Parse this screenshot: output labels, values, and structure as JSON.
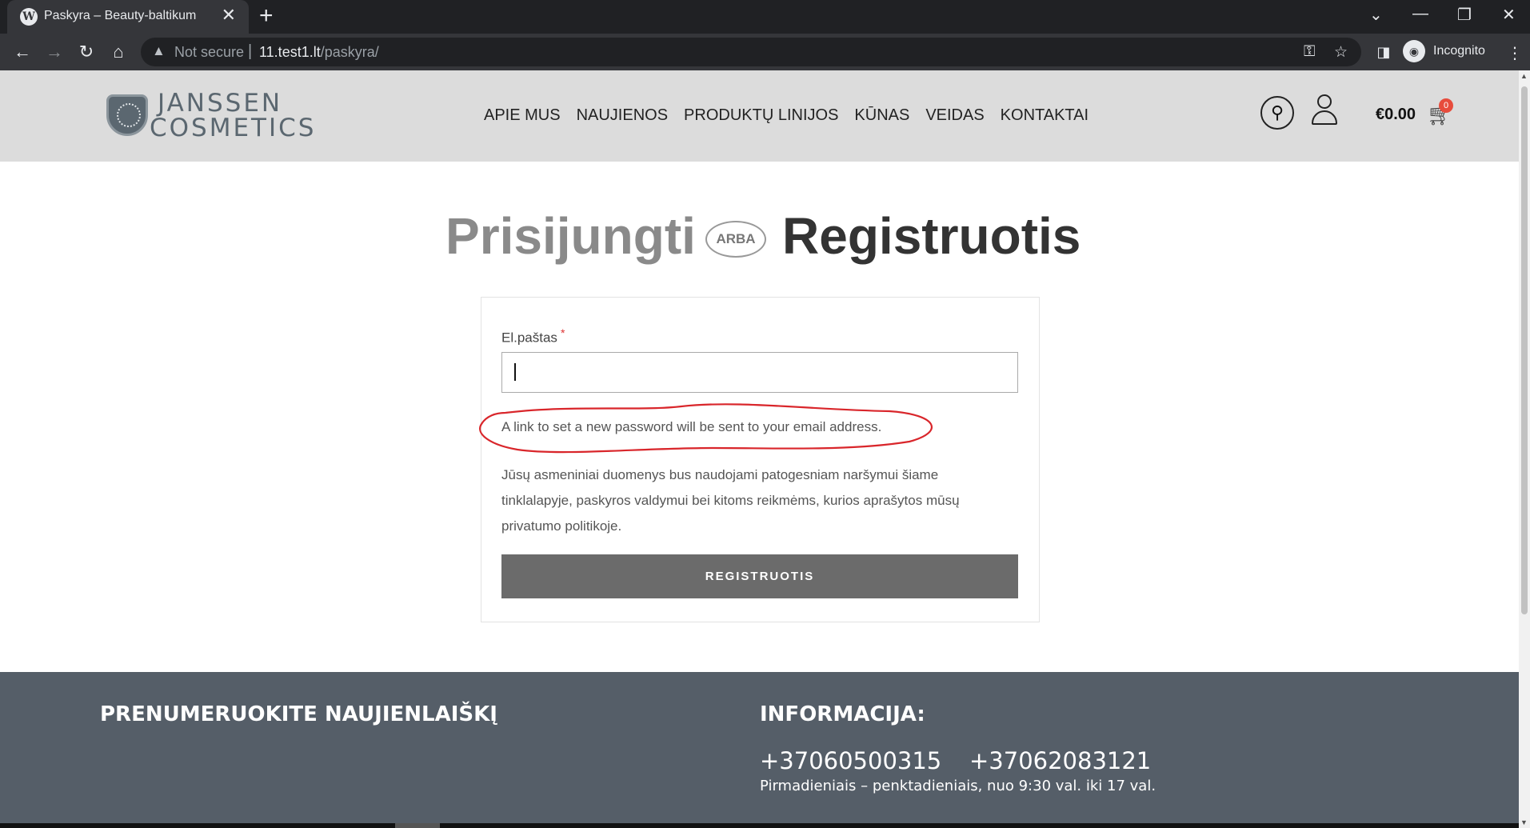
{
  "browser": {
    "tab_title": "Paskyra – Beauty-baltikum",
    "tab_favicon": "wordpress-icon",
    "new_tab_symbol": "+",
    "close_symbol": "✕",
    "minimize_symbol": "—",
    "restore_symbol": "❐",
    "win_close_symbol": "✕",
    "dropdown_symbol": "⌄",
    "security_label": "Not secure",
    "url_host": "11.test1.lt",
    "url_path": "/paskyra/",
    "incognito_label": "Incognito"
  },
  "header": {
    "logo_line1": "JANSSEN",
    "logo_line2": "COSMETICS",
    "nav": [
      {
        "label": "APIE MUS"
      },
      {
        "label": "NAUJIENOS"
      },
      {
        "label": "PRODUKTŲ LINIJOS"
      },
      {
        "label": "KŪNAS"
      },
      {
        "label": "VEIDAS"
      },
      {
        "label": "KONTAKTAI"
      }
    ],
    "cart_total": "€0.00",
    "cart_count": "0"
  },
  "main": {
    "login_heading": "Prisijungti",
    "or_label": "ARBA",
    "register_heading": "Registruotis",
    "email_label": "El.paštas",
    "required_mark": "*",
    "email_value": "",
    "password_note": "A link to set a new password will be sent to your email address.",
    "privacy_text": "Jūsų asmeniniai duomenys bus naudojami patogesniam naršymui šiame tinklalapyje, paskyros valdymui bei kitoms reikmėms, kurios aprašytos mūsų privatumo politikoje.",
    "register_button": "REGISTRUOTIS",
    "annotation_color": "#d9262b"
  },
  "footer": {
    "newsletter_heading": "PRENUMERUOKITE NAUJIENLAIŠKĮ",
    "info_heading": "INFORMACIJA:",
    "phone1": "+37060500315",
    "phone2": "+37062083121",
    "hours": "Pirmadieniais – penktadieniais, nuo 9:30 val. iki 17 val."
  }
}
